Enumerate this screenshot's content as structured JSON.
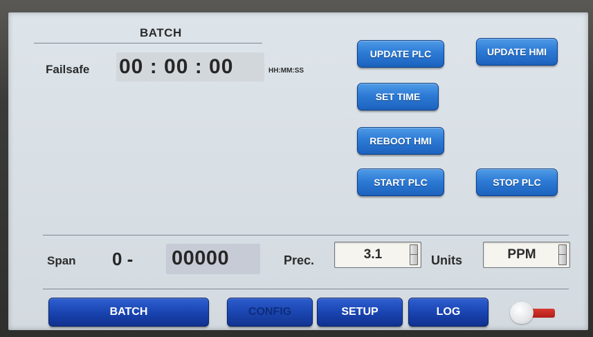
{
  "page": {
    "title": "BATCH"
  },
  "failsafe": {
    "label": "Failsafe",
    "value": "00 : 00 : 00",
    "format": "HH:MM:SS"
  },
  "buttons": {
    "update_plc": "UPDATE PLC",
    "update_hmi": "UPDATE HMI",
    "set_time": "SET TIME",
    "reboot_hmi": "REBOOT HMI",
    "start_plc": "START PLC",
    "stop_plc": "STOP PLC"
  },
  "span": {
    "label": "Span",
    "low": "0 -",
    "high": "00000"
  },
  "precision": {
    "label": "Prec.",
    "value": "3.1"
  },
  "units": {
    "label": "Units",
    "value": "PPM"
  },
  "nav": {
    "items": [
      {
        "label": "BATCH"
      },
      {
        "label": "CONFIG",
        "active": true
      },
      {
        "label": "SETUP"
      },
      {
        "label": "LOG"
      }
    ]
  },
  "toggle": {
    "state": "off",
    "accent_color": "#c62a22"
  },
  "colors": {
    "screen_bg": "#d9e0e6",
    "button_blue": "#2d7bd6",
    "nav_blue": "#1a45b3"
  }
}
